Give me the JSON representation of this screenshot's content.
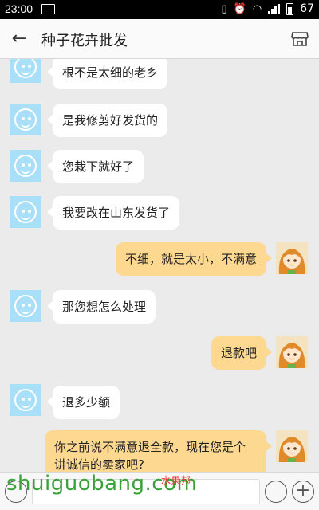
{
  "status_bar": {
    "time": "23:00",
    "battery": "67"
  },
  "nav": {
    "title": "种子花卉批发"
  },
  "messages": [
    {
      "side": "left",
      "text": "根不是太细的老乡"
    },
    {
      "side": "left",
      "text": "是我修剪好发货的"
    },
    {
      "side": "left",
      "text": "您栽下就好了"
    },
    {
      "side": "left",
      "text": "我要改在山东发货了"
    },
    {
      "side": "right",
      "text": "不细，就是太小，不满意"
    },
    {
      "side": "left",
      "text": "那您想怎么处理"
    },
    {
      "side": "right",
      "text": "退款吧"
    },
    {
      "side": "left",
      "text": "退多少额"
    },
    {
      "side": "right",
      "text": "你之前说不满意退全款，现在您是个讲诚信的卖家吧?"
    }
  ],
  "watermark": {
    "domain": "shuiguobang.com",
    "cn": "水果邦"
  },
  "colors": {
    "user_bubble": "#fcd891",
    "bot_avatar": "#a9dff7",
    "watermark": "#39a33a"
  }
}
